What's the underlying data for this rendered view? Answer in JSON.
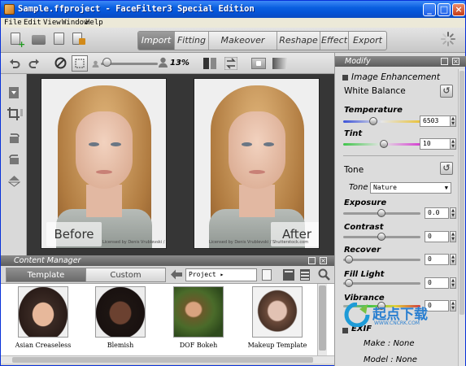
{
  "window": {
    "title": "Sample.ffproject - FaceFilter3 Special Edition",
    "controls": {
      "minimize": "_",
      "maximize": "□",
      "close": "×"
    }
  },
  "menu": [
    "File",
    "Edit",
    "View",
    "Window",
    "Help"
  ],
  "modules": {
    "tabs": [
      "Import",
      "Fitting",
      "Makeover",
      "Reshape",
      "Effect",
      "Export"
    ],
    "active": "Import"
  },
  "editor": {
    "zoom": "13%"
  },
  "canvas": {
    "before_label": "Before",
    "after_label": "After",
    "credit": "Licensed by Denis Vrublevski / Shutterstock.com"
  },
  "content_manager": {
    "title": "Content Manager",
    "tabs": [
      "Template",
      "Custom"
    ],
    "active_tab": "Template",
    "folder": "Project",
    "items": [
      {
        "label": "Asian Creaseless"
      },
      {
        "label": "Blemish"
      },
      {
        "label": "DOF Bokeh"
      },
      {
        "label": "Makeup Template"
      }
    ]
  },
  "modify": {
    "title": "Modify",
    "image_enhancement": {
      "heading": "Image Enhancement",
      "white_balance": "White Balance",
      "temperature_label": "Temperature",
      "temperature": "6503",
      "tint_label": "Tint",
      "tint": "10"
    },
    "tone": {
      "heading": "Tone",
      "tone_label": "Tone",
      "tone_value": "Nature",
      "exposure_label": "Exposure",
      "exposure": "0.0",
      "contrast_label": "Contrast",
      "contrast": "0",
      "recover_label": "Recover",
      "recover": "0",
      "fill_light_label": "Fill Light",
      "fill_light": "0",
      "vibrance_label": "Vibrance",
      "vibrance": "0"
    },
    "exif": {
      "heading": "EXIF",
      "make_label": "Make : ",
      "make": "None",
      "model_label": "Model : ",
      "model": "None"
    }
  },
  "watermark": {
    "text": "起点下载",
    "url": "WWW.CNCRK.COM"
  },
  "colors": {
    "title_blue": "#0553d6",
    "panel_header": "#6f6f6f",
    "canvas_bg": "#363636"
  },
  "icons": [
    "new-project-icon",
    "open-folder-icon",
    "save-icon",
    "save-as-icon",
    "undo-icon",
    "redo-icon",
    "clear-icon",
    "fit-icon",
    "compare-icon",
    "swap-icon",
    "spinner-icon"
  ]
}
